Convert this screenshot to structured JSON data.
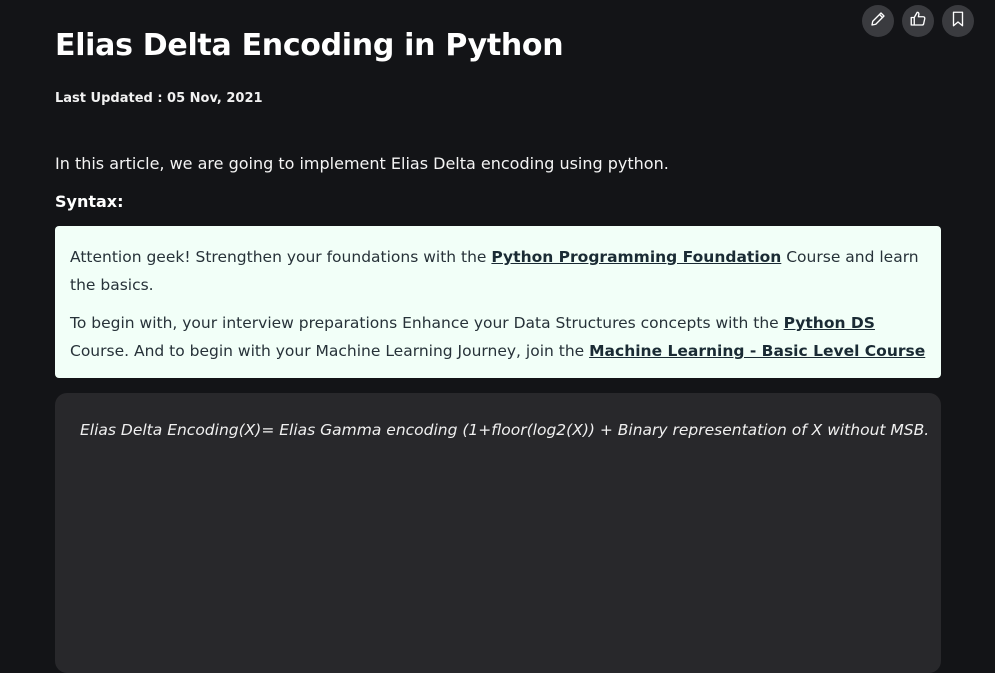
{
  "toolbar": {
    "edit_icon": "pencil-icon",
    "like_icon": "thumbs-up-icon",
    "bookmark_icon": "bookmark-icon"
  },
  "article": {
    "title": "Elias Delta Encoding in Python",
    "last_updated": "Last Updated : 05 Nov, 2021",
    "intro": "In this article, we are going to implement Elias Delta encoding using python.",
    "syntax_label": "Syntax:"
  },
  "notice": {
    "p1_prefix": " Attention geek! Strengthen your foundations with the ",
    "p1_link": "Python Programming Foundation",
    "p1_suffix": " Course and learn the basics.",
    "p2_prefix": "To begin with, your interview preparations Enhance your Data Structures concepts with the ",
    "p2_link1": "Python DS",
    "p2_middle": " Course. And to begin with your Machine Learning Journey, join the ",
    "p2_link2": "Machine Learning - Basic Level Course"
  },
  "code": {
    "formula": "Elias Delta Encoding(X)= Elias Gamma encoding (1+floor(log2(X)) + Binary representation of X without MSB."
  },
  "colors": {
    "background": "#131417",
    "notice_bg": "#f2fff8",
    "code_bg": "#28282b",
    "button_bg": "#3a3b3f"
  }
}
